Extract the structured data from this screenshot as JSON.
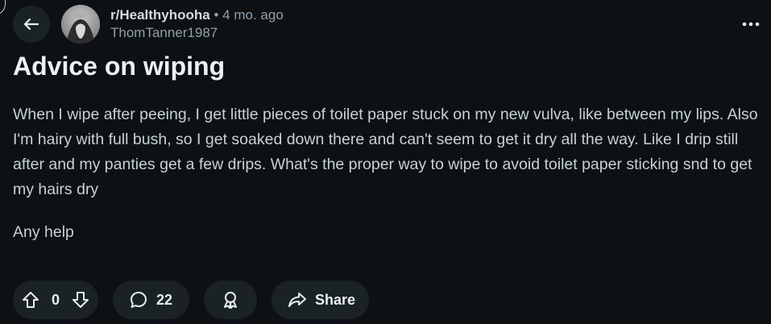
{
  "post": {
    "subreddit": "r/Healthyhooha",
    "separator": "•",
    "age": "4 mo. ago",
    "author": "ThomTanner1987",
    "title": "Advice on wiping",
    "body": [
      "When I wipe after peeing, I get little pieces of toilet paper stuck on my new vulva, like between my lips. Also I'm hairy with full bush, so I get soaked down there and can't seem to get it dry all the way. Like I drip still after and my panties get a few drips. What's the proper way to wipe to avoid toilet paper sticking snd to get my hairs dry",
      "Any help"
    ]
  },
  "actions": {
    "vote_count": "0",
    "comment_count": "22",
    "share_label": "Share"
  },
  "icons": {
    "back": "arrow-left-icon",
    "more": "more-dots-icon",
    "upvote": "arrow-up-icon",
    "downvote": "arrow-down-icon",
    "comment": "speech-bubble-icon",
    "award": "award-ribbon-icon",
    "share": "share-arrow-icon"
  },
  "colors": {
    "background": "#0e1113",
    "pill": "#1a2226",
    "title": "#eef1f3",
    "body_text": "#c4d2d9",
    "muted": "#8ba2ad"
  }
}
